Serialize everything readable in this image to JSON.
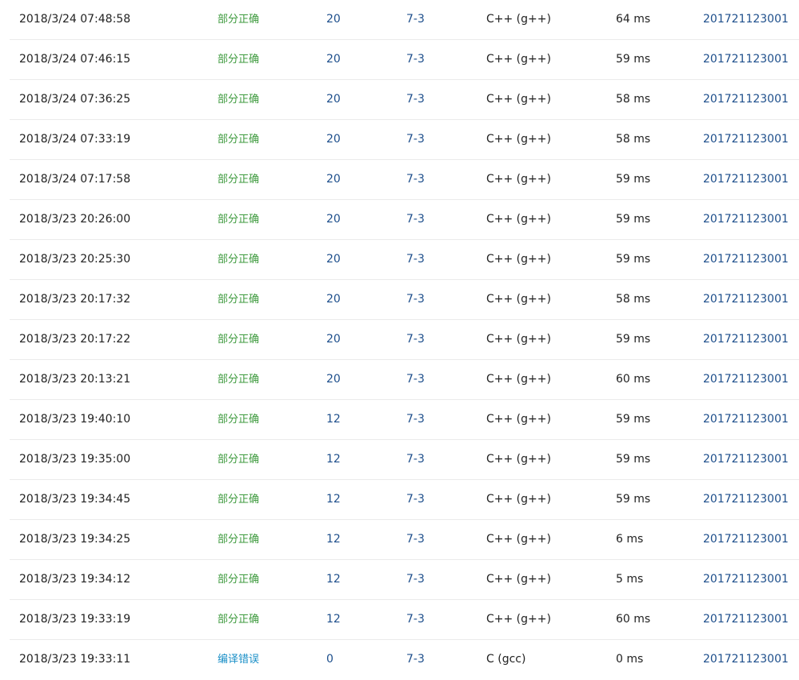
{
  "colors": {
    "partial": "#3d9a3d",
    "compile_error": "#1a8fc7",
    "link": "#1e4f8c",
    "divider": "#ebebeb"
  },
  "rows": [
    {
      "time": "2018/3/24 07:48:58",
      "status": "部分正确",
      "status_kind": "partial",
      "score": "20",
      "problem": "7-3",
      "lang": "C++ (g++)",
      "time_used": "64 ms",
      "user": "201721123001"
    },
    {
      "time": "2018/3/24 07:46:15",
      "status": "部分正确",
      "status_kind": "partial",
      "score": "20",
      "problem": "7-3",
      "lang": "C++ (g++)",
      "time_used": "59 ms",
      "user": "201721123001"
    },
    {
      "time": "2018/3/24 07:36:25",
      "status": "部分正确",
      "status_kind": "partial",
      "score": "20",
      "problem": "7-3",
      "lang": "C++ (g++)",
      "time_used": "58 ms",
      "user": "201721123001"
    },
    {
      "time": "2018/3/24 07:33:19",
      "status": "部分正确",
      "status_kind": "partial",
      "score": "20",
      "problem": "7-3",
      "lang": "C++ (g++)",
      "time_used": "58 ms",
      "user": "201721123001"
    },
    {
      "time": "2018/3/24 07:17:58",
      "status": "部分正确",
      "status_kind": "partial",
      "score": "20",
      "problem": "7-3",
      "lang": "C++ (g++)",
      "time_used": "59 ms",
      "user": "201721123001"
    },
    {
      "time": "2018/3/23 20:26:00",
      "status": "部分正确",
      "status_kind": "partial",
      "score": "20",
      "problem": "7-3",
      "lang": "C++ (g++)",
      "time_used": "59 ms",
      "user": "201721123001"
    },
    {
      "time": "2018/3/23 20:25:30",
      "status": "部分正确",
      "status_kind": "partial",
      "score": "20",
      "problem": "7-3",
      "lang": "C++ (g++)",
      "time_used": "59 ms",
      "user": "201721123001"
    },
    {
      "time": "2018/3/23 20:17:32",
      "status": "部分正确",
      "status_kind": "partial",
      "score": "20",
      "problem": "7-3",
      "lang": "C++ (g++)",
      "time_used": "58 ms",
      "user": "201721123001"
    },
    {
      "time": "2018/3/23 20:17:22",
      "status": "部分正确",
      "status_kind": "partial",
      "score": "20",
      "problem": "7-3",
      "lang": "C++ (g++)",
      "time_used": "59 ms",
      "user": "201721123001"
    },
    {
      "time": "2018/3/23 20:13:21",
      "status": "部分正确",
      "status_kind": "partial",
      "score": "20",
      "problem": "7-3",
      "lang": "C++ (g++)",
      "time_used": "60 ms",
      "user": "201721123001"
    },
    {
      "time": "2018/3/23 19:40:10",
      "status": "部分正确",
      "status_kind": "partial",
      "score": "12",
      "problem": "7-3",
      "lang": "C++ (g++)",
      "time_used": "59 ms",
      "user": "201721123001"
    },
    {
      "time": "2018/3/23 19:35:00",
      "status": "部分正确",
      "status_kind": "partial",
      "score": "12",
      "problem": "7-3",
      "lang": "C++ (g++)",
      "time_used": "59 ms",
      "user": "201721123001"
    },
    {
      "time": "2018/3/23 19:34:45",
      "status": "部分正确",
      "status_kind": "partial",
      "score": "12",
      "problem": "7-3",
      "lang": "C++ (g++)",
      "time_used": "59 ms",
      "user": "201721123001"
    },
    {
      "time": "2018/3/23 19:34:25",
      "status": "部分正确",
      "status_kind": "partial",
      "score": "12",
      "problem": "7-3",
      "lang": "C++ (g++)",
      "time_used": "6 ms",
      "user": "201721123001"
    },
    {
      "time": "2018/3/23 19:34:12",
      "status": "部分正确",
      "status_kind": "partial",
      "score": "12",
      "problem": "7-3",
      "lang": "C++ (g++)",
      "time_used": "5 ms",
      "user": "201721123001"
    },
    {
      "time": "2018/3/23 19:33:19",
      "status": "部分正确",
      "status_kind": "partial",
      "score": "12",
      "problem": "7-3",
      "lang": "C++ (g++)",
      "time_used": "60 ms",
      "user": "201721123001"
    },
    {
      "time": "2018/3/23 19:33:11",
      "status": "编译错误",
      "status_kind": "compile_error",
      "score": "0",
      "problem": "7-3",
      "lang": "C (gcc)",
      "time_used": "0 ms",
      "user": "201721123001"
    }
  ]
}
